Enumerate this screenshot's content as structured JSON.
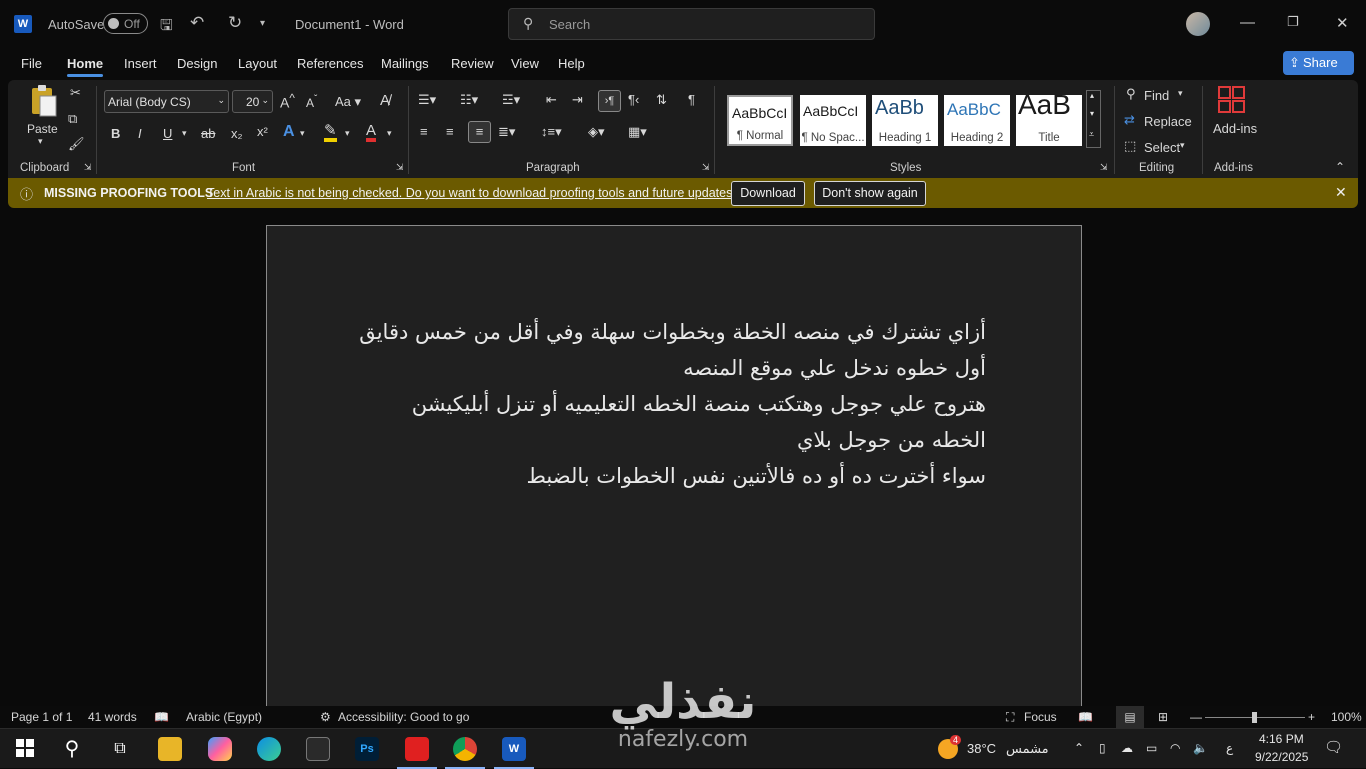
{
  "titlebar": {
    "autosave_label": "AutoSave",
    "autosave_state": "Off",
    "doc_title": "Document1  -  Word",
    "search_placeholder": "Search",
    "app_icon_letter": "W"
  },
  "tabs": [
    "File",
    "Home",
    "Insert",
    "Design",
    "Layout",
    "References",
    "Mailings",
    "Review",
    "View",
    "Help"
  ],
  "share_label": "Share",
  "ribbon": {
    "clipboard": {
      "paste": "Paste",
      "label": "Clipboard"
    },
    "font": {
      "name": "Arial (Body CS)",
      "size": "20",
      "label": "Font",
      "bold": "B",
      "italic": "I",
      "underline": "U",
      "strike": "ab",
      "sub": "x₂",
      "sup": "x²",
      "case": "Aa"
    },
    "paragraph": {
      "label": "Paragraph"
    },
    "styles": {
      "label": "Styles",
      "items": [
        {
          "preview": "AaBbCcI",
          "name": "¶ Normal"
        },
        {
          "preview": "AaBbCcI",
          "name": "¶ No Spac..."
        },
        {
          "preview": "AaBb",
          "name": "Heading 1"
        },
        {
          "preview": "AaBbC",
          "name": "Heading 2"
        },
        {
          "preview": "AaB",
          "name": "Title"
        }
      ]
    },
    "editing": {
      "find": "Find",
      "replace": "Replace",
      "select": "Select",
      "label": "Editing"
    },
    "addins": {
      "button": "Add-ins",
      "label": "Add-ins"
    }
  },
  "infobar": {
    "title": "MISSING PROOFING TOOLS",
    "message": "Text in Arabic is not being checked. Do you want to download proofing tools and future updates?",
    "download": "Download",
    "dismiss": "Don't show again"
  },
  "document": {
    "lines": [
      "أزاي تشترك في منصه الخطة وبخطوات سهلة وفي أقل من خمس دقايق",
      "أول خطوه ندخل علي موقع المنصه",
      "هتروح علي جوجل وهتكتب منصة الخطه التعليميه أو تنزل أبليكيشن",
      "الخطه من جوجل بلاي",
      "سواء أخترت ده أو ده فالأتنين نفس الخطوات بالضبط"
    ]
  },
  "statusbar": {
    "page": "Page 1 of 1",
    "words": "41 words",
    "language": "Arabic (Egypt)",
    "accessibility": "Accessibility: Good to go",
    "focus": "Focus",
    "zoom": "100%"
  },
  "taskbar": {
    "weather_temp": "38°C",
    "weather_desc": "مشمس",
    "weather_badge": "4",
    "lang": "ع",
    "time": "4:16 PM",
    "date": "9/22/2025",
    "ps_label": "Ps",
    "word_label": "W"
  },
  "watermark": {
    "arabic": "نفذلي",
    "latin": "nafezly.com"
  },
  "colors": {
    "accent": "#4a90e2",
    "infobar": "#6b5a00",
    "word_blue": "#185abd"
  }
}
